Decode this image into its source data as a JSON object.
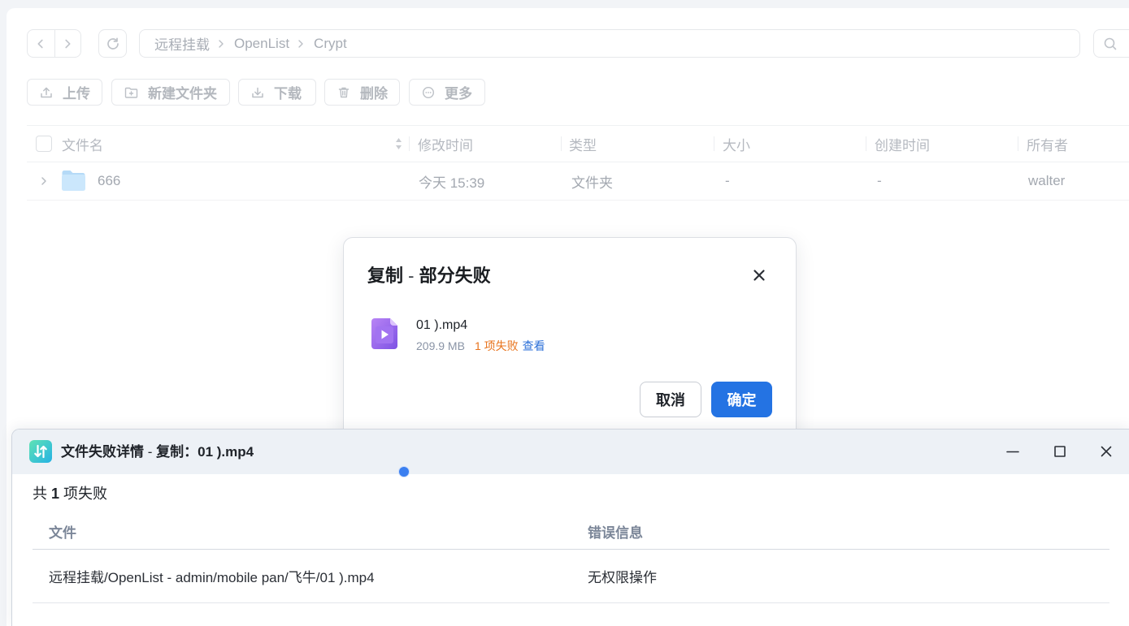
{
  "nav": {
    "back_icon": "chevron-left-icon",
    "forward_icon": "chevron-right-icon",
    "refresh_icon": "refresh-icon"
  },
  "breadcrumb": [
    "远程挂载",
    "OpenList",
    "Crypt"
  ],
  "search": {
    "icon": "search-icon"
  },
  "actions": [
    {
      "label": "上传",
      "icon": "upload-icon"
    },
    {
      "label": "新建文件夹",
      "icon": "new-folder-icon"
    },
    {
      "label": "下载",
      "icon": "download-icon"
    },
    {
      "label": "删除",
      "icon": "trash-icon"
    },
    {
      "label": "更多",
      "icon": "more-icon"
    }
  ],
  "file_table": {
    "columns": [
      "文件名",
      "修改时间",
      "类型",
      "大小",
      "创建时间",
      "所有者"
    ],
    "rows": [
      {
        "name": "666",
        "modified": "今天 15:39",
        "type": "文件夹",
        "size": "-",
        "created": "-",
        "owner": "walter",
        "icon": "folder-icon"
      }
    ]
  },
  "copy_dialog": {
    "title": {
      "action": "复制",
      "separator": "-",
      "status": "部分失败"
    },
    "file": {
      "name": "01 ).mp4",
      "size": "209.9 MB",
      "failed": "1 项失败",
      "view_link": "查看",
      "icon": "video-file-icon"
    },
    "cancel_label": "取消",
    "confirm_label": "确定"
  },
  "failure_window": {
    "title": {
      "main": "文件失败详情",
      "separator": "-",
      "detail": "复制：01 ).mp4"
    },
    "summary": {
      "prefix": "共",
      "count": "1",
      "suffix": "项失败"
    },
    "columns": [
      "文件",
      "错误信息"
    ],
    "rows": [
      {
        "file": "远程挂载/OpenList - admin/mobile pan/飞牛/01 ).mp4",
        "error": "无权限操作"
      }
    ]
  },
  "colors": {
    "accent": "#2473e3",
    "warning": "#e8731c",
    "link": "#2b6fd8",
    "title_bar": "#edf1f6",
    "cursor_dot": "#3b7ff0"
  }
}
